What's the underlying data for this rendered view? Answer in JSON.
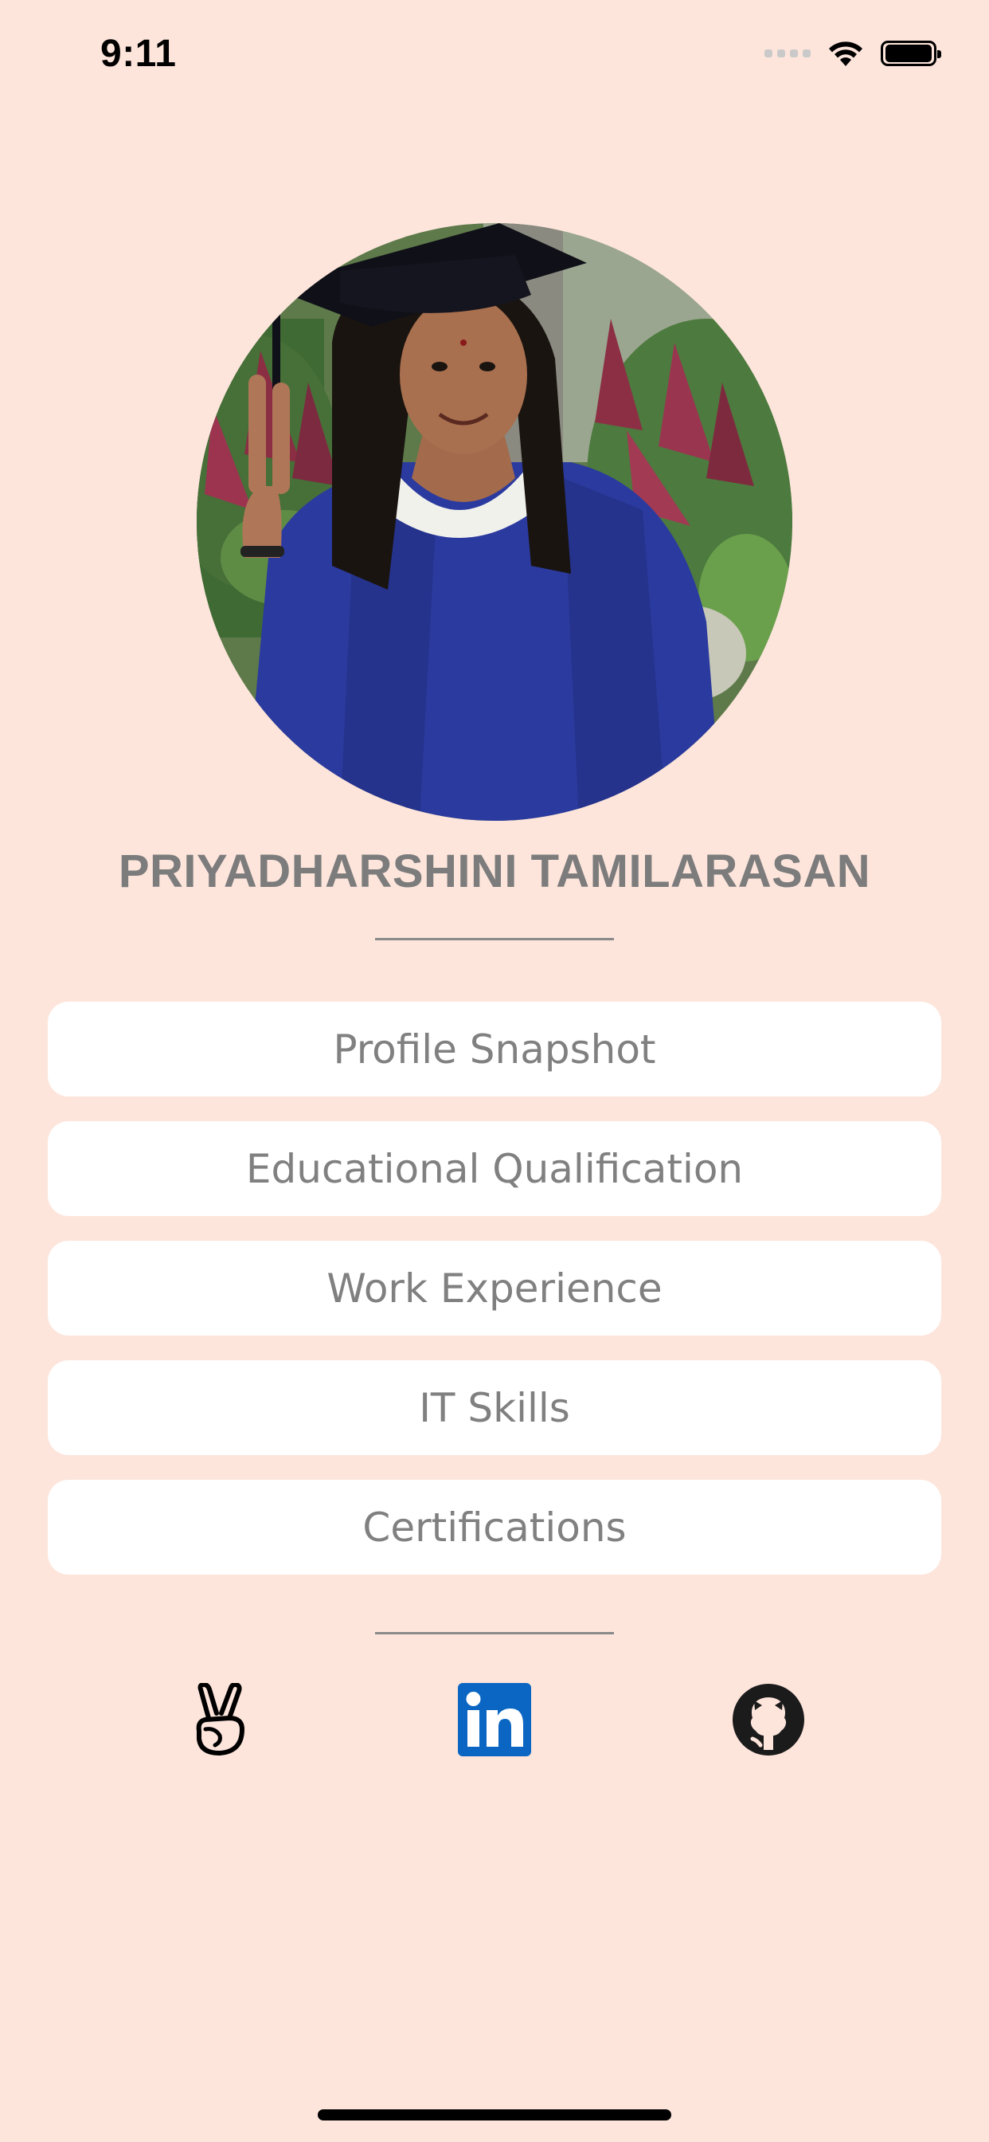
{
  "status_bar": {
    "time": "9:11"
  },
  "profile": {
    "name": "PRIYADHARSHINI TAMILARASAN",
    "avatar_icon": "graduate-photo"
  },
  "menu": {
    "items": [
      {
        "label": "Profile Snapshot"
      },
      {
        "label": "Educational Qualification"
      },
      {
        "label": "Work Experience"
      },
      {
        "label": "IT Skills"
      },
      {
        "label": "Certifications"
      }
    ]
  },
  "social": {
    "links": [
      {
        "icon": "angellist-icon"
      },
      {
        "icon": "linkedin-icon",
        "color": "#0a66c2"
      },
      {
        "icon": "github-icon",
        "color": "#1b1b1b"
      }
    ]
  },
  "colors": {
    "background": "#fde5dc",
    "button": "#ffffff",
    "text": "#808080"
  }
}
